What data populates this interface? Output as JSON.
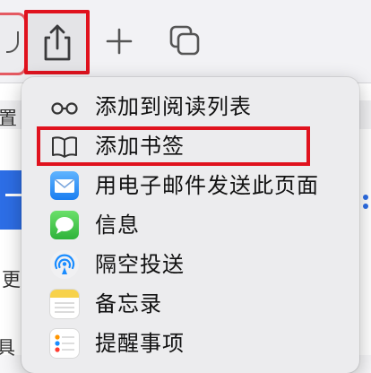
{
  "toolbar": {
    "share_icon": "share-icon",
    "new_tab_icon": "plus-icon",
    "tab_overview_icon": "tabs-icon"
  },
  "background": {
    "text_1": "置",
    "text_2": "更",
    "text_3": "具"
  },
  "share_menu": {
    "items": [
      {
        "label": "添加到阅读列表",
        "icon": "glasses-icon"
      },
      {
        "label": "添加书签",
        "icon": "book-icon"
      },
      {
        "label": "用电子邮件发送此页面",
        "icon": "mail-icon"
      },
      {
        "label": "信息",
        "icon": "messages-icon"
      },
      {
        "label": "隔空投送",
        "icon": "airdrop-icon"
      },
      {
        "label": "备忘录",
        "icon": "notes-icon"
      },
      {
        "label": "提醒事项",
        "icon": "reminders-icon"
      }
    ]
  },
  "colors": {
    "highlight_red": "#e0121e",
    "menu_bg": "#ececee",
    "accent_blue": "#2d6ee6"
  }
}
